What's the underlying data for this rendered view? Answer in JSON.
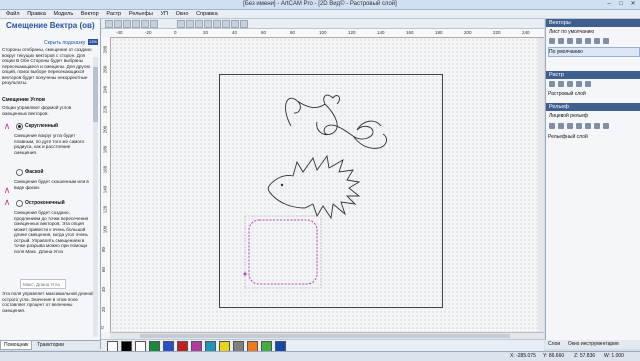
{
  "window": {
    "title": "[Без имени] - ArtCAM Pro - [2D Вид© - Растровый слой]"
  },
  "menu": [
    "Файл",
    "Правка",
    "Модель",
    "Вектор",
    "Растр",
    "Рельефы",
    "УП",
    "Окно",
    "Справка"
  ],
  "left_panel": {
    "title": "Смещение Вектра (ов)",
    "help_link": "Скрыть подсказку",
    "badge": "13%",
    "intro": "Стороны отобраны, смещение от создано вокруг текущих векторов с сторон. Для опции В Обе Стороны будет выбраны пересекающиеся и смещены. Для других опций, поиск выборе пересекающихся векторов будет получены некорректные результаты.",
    "section_title": "Смещение Углов",
    "section_desc": "Опции управляют формой углов смещенных векторов.",
    "options": [
      {
        "label": "Скругленный",
        "selected": true,
        "desc": "Смещение вокруг угла будет плавным, по дуге того же самого радиуса, как и расстояние смещения."
      },
      {
        "label": "Фаской",
        "selected": false,
        "desc": "Смещение будет скошенным или в виде фаски."
      },
      {
        "label": "Остроконечный",
        "selected": false,
        "desc": "Смещение будет создано, продлением до точки пересечения смещенных векторов. Эта опция может привести к очень большой длине смещения, когда угол очень острый. Управлять смещением в точке разрыва можно при помощи поля Макс. Длина Угла"
      }
    ],
    "field_placeholder": "Макс. Длина Угла",
    "footer_text": "Эта поля управляет максимальной длиной острого угла. Значение в этом поле составляет процент от величины смещения.",
    "tabs": [
      "Помощник",
      "Траектории"
    ]
  },
  "rulers": {
    "top": [
      "-40",
      "-20",
      "0",
      "20",
      "40",
      "60",
      "80",
      "100",
      "120",
      "140",
      "160",
      "180",
      "200",
      "220",
      "240"
    ],
    "left": [
      "280",
      "260",
      "240",
      "220",
      "200",
      "180",
      "160",
      "140",
      "120",
      "100",
      "80",
      "60",
      "40",
      "20",
      "0"
    ]
  },
  "right_panel": {
    "vectors_head": "Векторы",
    "vectors_list": "Лист по умолчанию",
    "vectors_item": "По умолчанию",
    "raster_head": "Растр",
    "raster_item": "Растровый слой",
    "relief_head": "Рельеф",
    "relief_list": "Лицевой рельеф",
    "relief_item": "Рельефный слой",
    "tabs": [
      "Слои",
      "Окно инструментария"
    ]
  },
  "palette": {
    "colors": [
      "#ffffff",
      "#000000",
      "#ffffff",
      "#1a8a3a",
      "#2a50c8",
      "#c02020",
      "#b43a9c",
      "#1a9ab8",
      "#e8d21a",
      "#808080",
      "#f07818",
      "#3fb040",
      "#1848a8"
    ]
  },
  "status": {
    "x": "X: -285.075",
    "y": "Y: 86.660",
    "z": "Z: 57.836",
    "w": "W: 1.000"
  }
}
